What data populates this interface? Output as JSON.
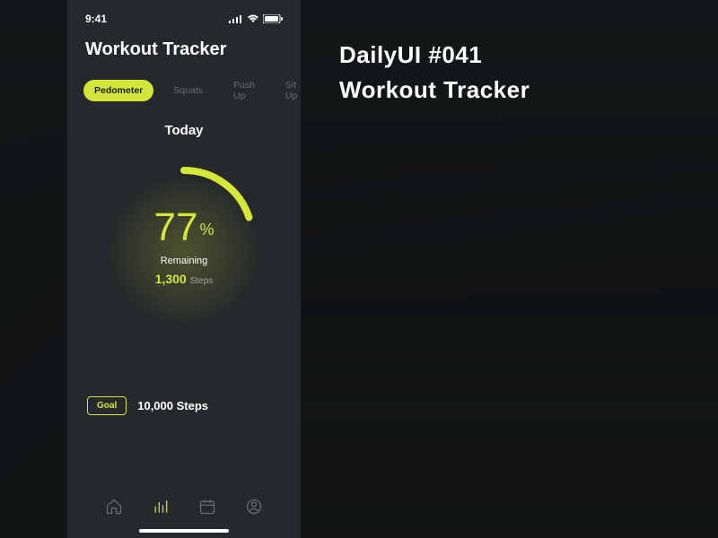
{
  "side": {
    "line1": "DailyUI  #041",
    "line2": "Workout Tracker"
  },
  "statusBar": {
    "time": "9:41"
  },
  "header": {
    "title": "Workout Tracker"
  },
  "tabs": [
    {
      "label": "Pedometer",
      "active": true
    },
    {
      "label": "Squats",
      "active": false
    },
    {
      "label": "Push Up",
      "active": false
    },
    {
      "label": "Sit Up",
      "active": false
    }
  ],
  "progress": {
    "periodLabel": "Today",
    "percent": "77",
    "percentSign": "%",
    "remainingLabel": "Remaining",
    "remainingValue": "1,300",
    "remainingUnit": "Steps"
  },
  "goal": {
    "badgeLabel": "Goal",
    "value": "10,000 Steps"
  },
  "nav": {
    "items": [
      "home",
      "stats",
      "calendar",
      "profile"
    ],
    "activeIndex": 1
  },
  "colors": {
    "accent": "#d4e63a",
    "background": "#26292b",
    "textMuted": "#6a6d6f"
  },
  "chart_data": {
    "type": "gauge",
    "title": "Today",
    "value": 77,
    "max": 100,
    "unit": "%",
    "remaining_steps": 1300,
    "goal_steps": 10000
  }
}
